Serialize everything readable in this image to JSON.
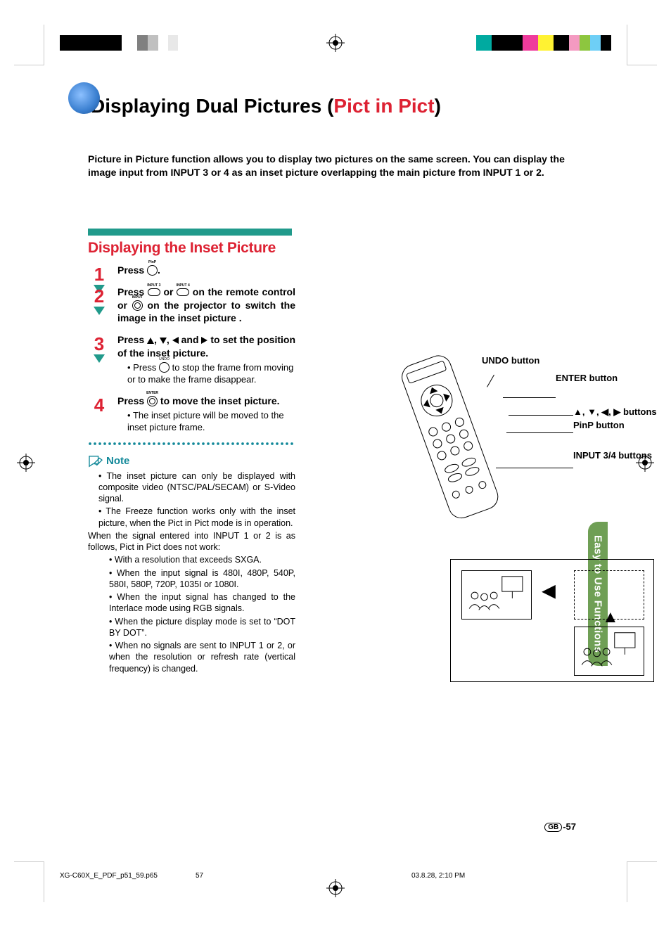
{
  "printer_bars": {
    "left": [
      "#000000",
      "#000000",
      "#000000",
      "#000000",
      "#ffffff",
      "#808080",
      "#c0c0c0",
      "#ffffff",
      "#e2e2e2",
      "#ffffff"
    ],
    "right": [
      "#00aaa0",
      "#000000",
      "#000000",
      "#ef3b9c",
      "#fff232",
      "#000000",
      "#f49ac1",
      "#8dc63f",
      "#6ecff6",
      "#000000"
    ]
  },
  "heading": {
    "prefix": "Displaying Dual Pictures (",
    "highlight": "Pict in Pict",
    "suffix": ")"
  },
  "intro": "Picture in Picture function allows you to display two pictures on the same screen. You can display the image input from INPUT 3 or 4 as an inset picture overlapping the main picture from INPUT 1 or 2.",
  "section_title": "Displaying the Inset Picture",
  "steps": {
    "1": {
      "lead_a": "Press ",
      "lead_b": ".",
      "icon_label": "PinP"
    },
    "2": {
      "lead_a": "Press ",
      "lead_b": " or ",
      "lead_c": " on the remote control or ",
      "lead_d": " on the projector to switch the image in the inset picture .",
      "icon1": "INPUT 3",
      "icon2": "INPUT 4",
      "icon3": "INPUT"
    },
    "3": {
      "lead_a": "Press ",
      "lead_b": " and ",
      "lead_c": " to set the position of the inset picture.",
      "sub_a": "Press ",
      "sub_b": " to stop the frame from moving or to make the frame disappear.",
      "sub_icon": "UNDO"
    },
    "4": {
      "lead_a": "Press ",
      "lead_b": " to move the inset picture.",
      "icon_label": "ENTER",
      "sub": "The inset picture will be moved to the inset picture frame."
    }
  },
  "note_label": "Note",
  "note_bullets": {
    "b1": "The inset picture can only be displayed with composite video (NTSC/PAL/SECAM) or S-Video signal.",
    "b2": "The Freeze function works only with the inset picture, when the Pict in Pict mode is in operation.",
    "b3": "When the signal entered into INPUT 1 or 2 is as follows, Pict in Pict does not work:",
    "b3a": "With a resolution that exceeds SXGA.",
    "b3b": "When the input signal is 480I, 480P, 540P, 580I, 580P, 720P, 1035I or 1080I.",
    "b3c": "When the input signal has changed to the Interlace mode using RGB signals.",
    "b3d": "When the picture display mode is set to “DOT BY DOT”.",
    "b3e": "When no signals are sent to INPUT 1 or 2, or when the resolution or refresh rate (vertical frequency) is changed."
  },
  "callouts": {
    "undo": "UNDO button",
    "enter": "ENTER button",
    "arrows_a": "▲, ▼, ◀, ▶ buttons",
    "pinp": "PinP button",
    "input34": "INPUT 3/4 buttons"
  },
  "section_tab": "Easy to Use Functions",
  "page_number": "-57",
  "gb_label": "GB",
  "footer": {
    "file": "XG-C60X_E_PDF_p51_59.p65",
    "page": "57",
    "date": "03.8.28, 2:10 PM"
  }
}
